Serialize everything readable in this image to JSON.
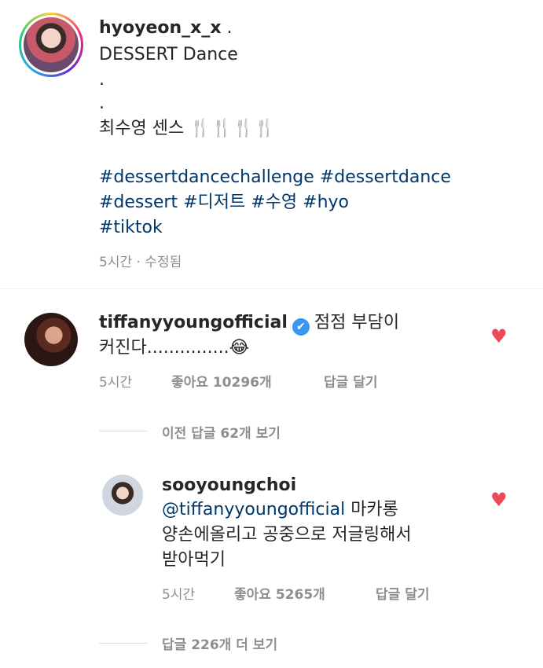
{
  "post": {
    "username": "hyoyeon_x_x",
    "after_username": " .",
    "caption_line1": "DESSERT Dance",
    "dot1": ".",
    "dot2": ".",
    "caption_line4": "최수영 센스 🍴🍴🍴🍴",
    "hashtags": [
      "#dessertdancechallenge",
      "#dessertdance",
      "#dessert",
      "#디저트",
      "#수영",
      "#hyo",
      "#tiktok"
    ],
    "meta": "5시간 · 수정됨"
  },
  "comment": {
    "username": "tiffanyyoungofficial",
    "verified_glyph": "✔",
    "text_line1": "점점 부담이",
    "text_line2": "커진다...............😂",
    "time": "5시간",
    "likes_label": "좋아요 10296개",
    "reply_label": "답글 달기",
    "view_previous": "이전 답글 62개 보기"
  },
  "reply": {
    "username": "sooyoungchoi",
    "mention": "@tiffanyyoungofficial",
    "text_line1": " 마카롱",
    "text_line2": "양손에올리고 공중으로 저글링해서",
    "text_line3": "받아먹기",
    "time": "5시간",
    "likes_label": "좋아요 5265개",
    "reply_label": "답글 달기",
    "view_more": "답글 226개 더 보기"
  },
  "icons": {
    "heart": "heart-icon",
    "verified": "verified-badge-icon"
  },
  "colors": {
    "hashtag": "#00376b",
    "heart": "#ed4956",
    "verified": "#3897f0",
    "meta": "#8e8e8e"
  }
}
